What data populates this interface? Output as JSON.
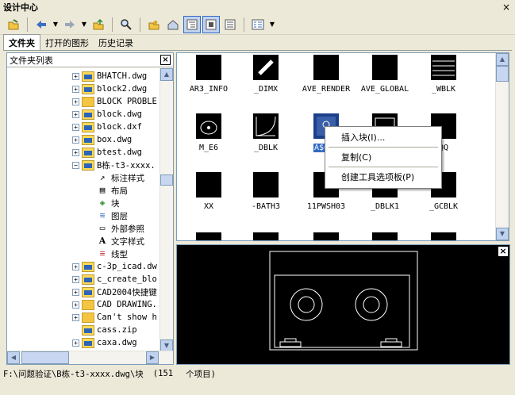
{
  "window": {
    "title": "设计中心",
    "close": "×"
  },
  "toolbar": {
    "icons": [
      "load-icon",
      "back-icon",
      "forward-icon",
      "up-icon",
      "search-icon",
      "favorites-icon",
      "home-icon",
      "tree-toggle-icon",
      "preview-icon",
      "description-icon",
      "views-icon"
    ]
  },
  "tabs": [
    {
      "label": "文件夹"
    },
    {
      "label": "打开的图形"
    },
    {
      "label": "历史记录"
    }
  ],
  "tree": {
    "header": "文件夹列表",
    "close": "×",
    "items": [
      {
        "label": "BHATCH.dwg",
        "kind": "dwg"
      },
      {
        "label": "block2.dwg",
        "kind": "dwg"
      },
      {
        "label": "BLOCK PROBLE",
        "kind": "folder"
      },
      {
        "label": "block.dwg",
        "kind": "dwg"
      },
      {
        "label": "block.dxf",
        "kind": "dwg"
      },
      {
        "label": "box.dwg",
        "kind": "dwg"
      },
      {
        "label": "btest.dwg",
        "kind": "dwg"
      },
      {
        "label": "B栋-t3-xxxx.",
        "kind": "dwg"
      },
      {
        "label": "标注样式",
        "kind": "res"
      },
      {
        "label": "布局",
        "kind": "res"
      },
      {
        "label": "块",
        "kind": "res"
      },
      {
        "label": "图层",
        "kind": "res"
      },
      {
        "label": "外部参照",
        "kind": "res"
      },
      {
        "label": "文字样式",
        "kind": "res"
      },
      {
        "label": "线型",
        "kind": "res"
      },
      {
        "label": "c-3p_icad.dw",
        "kind": "dwg"
      },
      {
        "label": "c_create_blo",
        "kind": "dwg"
      },
      {
        "label": "CAD2004快捷键",
        "kind": "dwg"
      },
      {
        "label": "CAD DRAWING.",
        "kind": "folder"
      },
      {
        "label": "Can't show h",
        "kind": "folder"
      },
      {
        "label": "cass.zip",
        "kind": "dwg"
      },
      {
        "label": "caxa.dwg",
        "kind": "dwg"
      }
    ],
    "scroll_up": "▲",
    "scroll_down": "▼",
    "scroll_left": "◀",
    "scroll_right": "▶"
  },
  "blocks": [
    {
      "label": "AR3_INFO"
    },
    {
      "label": "_DIMX"
    },
    {
      "label": "AVE_RENDER"
    },
    {
      "label": "AVE_GLOBAL"
    },
    {
      "label": "_WBLK"
    },
    {
      "label": "M_E6"
    },
    {
      "label": "_DBLK"
    },
    {
      "label": "A$C5E",
      "selected": true
    },
    {
      "label": ""
    },
    {
      "label": "QQ"
    },
    {
      "label": "XX"
    },
    {
      "label": "-BATH3"
    },
    {
      "label": "11PWSH03"
    },
    {
      "label": "_DBLK1"
    },
    {
      "label": "_GCBLK"
    }
  ],
  "context_menu": {
    "items": [
      {
        "label": "插入块(I)..."
      },
      {
        "label": "复制(C)"
      },
      {
        "label": "创建工具选项板(P)"
      }
    ]
  },
  "preview": {
    "close": "×"
  },
  "status": {
    "path": "F:\\问题验证\\B栋-t3-xxxx.dwg\\块",
    "count": "(151",
    "unit": "个项目)"
  }
}
